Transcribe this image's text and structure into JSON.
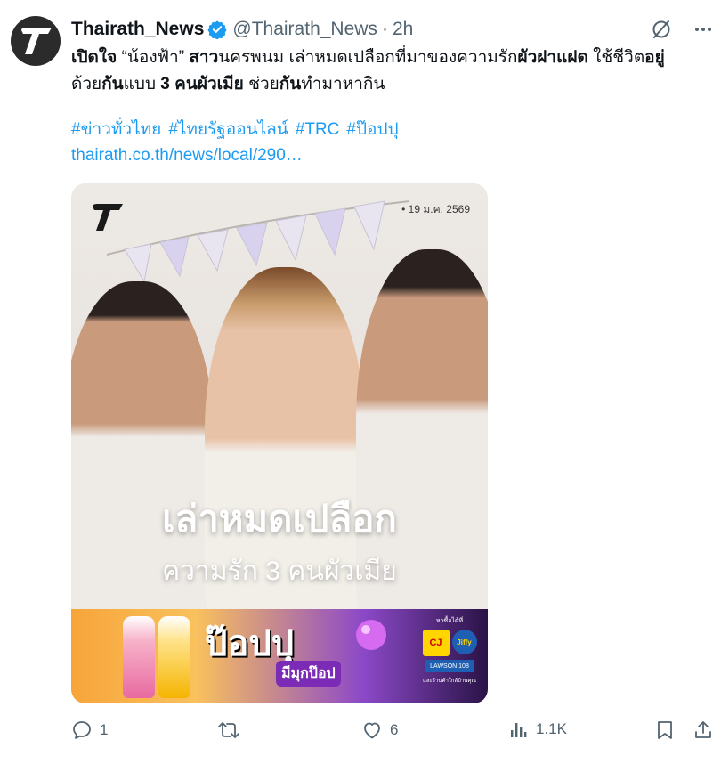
{
  "account": {
    "display_name": "Thairath_News",
    "handle": "@Thairath_News",
    "separator": "·",
    "time": "2h",
    "avatar_letter": "T"
  },
  "tweet": {
    "text_parts": [
      {
        "text": "เปิดใจ",
        "bold": true
      },
      {
        "text": " “น้องฟ้า” ",
        "bold": false
      },
      {
        "text": "สาว",
        "bold": true
      },
      {
        "text": "นครพนม เล่าหมดเปลือกที่มาของความรัก",
        "bold": false
      },
      {
        "text": "ผัวฝาแฝด",
        "bold": true
      },
      {
        "text": " ใช้ชีวิต",
        "bold": false
      },
      {
        "text": "อยู่",
        "bold": true
      },
      {
        "text": "ด้วย",
        "bold": false
      },
      {
        "text": "กัน",
        "bold": true
      },
      {
        "text": "แบบ ",
        "bold": false
      },
      {
        "text": "3 คนผัวเมีย",
        "bold": true
      },
      {
        "text": " ช่วย",
        "bold": false
      },
      {
        "text": "กัน",
        "bold": true
      },
      {
        "text": "ทำมาหากิน",
        "bold": false
      }
    ],
    "hashtags": [
      "#ข่าวทั่วไทย",
      "#ไทยรัฐออนไลน์",
      "#TRC",
      "#ป๊อปปุ"
    ],
    "link": "thairath.co.th/news/local/290…"
  },
  "media": {
    "date": "• 19 ม.ค. 2569",
    "headline": "เล่าหมดเปลือก",
    "subheadline": "ความรัก 3 คนผัวเมีย",
    "ad": {
      "brand": "ป๊อปปุ",
      "tagline": "มีมุกป๊อป",
      "stores_label": "หาซื้อได้ที่",
      "store_cj": "CJ",
      "store_jiffy": "Jiffy",
      "store_lawson": "LAWSON 108",
      "footer": "และร้านค้าใกล้บ้านคุณ"
    }
  },
  "actions": {
    "reply_count": "1",
    "retweet_count": "",
    "like_count": "6",
    "view_count": "1.1K"
  },
  "colors": {
    "link": "#1d9bf0",
    "muted": "#536471",
    "verified": "#1d9bf0"
  }
}
